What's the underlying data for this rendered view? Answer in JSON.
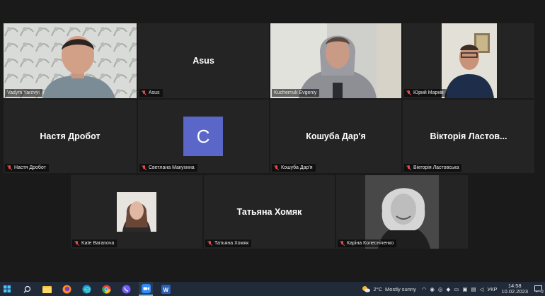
{
  "participants": [
    {
      "name": "Vadym Yarovyi",
      "display": "",
      "video": true,
      "muted": false
    },
    {
      "name": "Asus",
      "display": "Asus",
      "video": false,
      "muted": true
    },
    {
      "name": "Kuchernuk Evgeniy",
      "display": "",
      "video": true,
      "muted": false
    },
    {
      "name": "Юрий Марків",
      "display": "",
      "video": true,
      "muted": true
    },
    {
      "name": "Настя Дробот",
      "display": "Настя Дробот",
      "video": false,
      "muted": true
    },
    {
      "name": "Светлана Макухина",
      "display": "",
      "avatar_letter": "C",
      "video": false,
      "muted": true
    },
    {
      "name": "Кошуба Дар'я",
      "display": "Кошуба Дар'я",
      "video": false,
      "muted": true
    },
    {
      "name": "Вікторія Ластовська",
      "display": "Вікторія Ластов...",
      "video": false,
      "muted": true
    },
    {
      "name": "Kate Baranova",
      "display": "",
      "video": true,
      "muted": true
    },
    {
      "name": "Татьяна Хомяк",
      "display": "Татьяна Хомяк",
      "video": false,
      "muted": true
    },
    {
      "name": "Каріна Колесніченко",
      "display": "",
      "video": true,
      "muted": true
    }
  ],
  "taskbar": {
    "weather_temp": "2°C",
    "weather_text": "Mostly sunny",
    "language": "УКР",
    "time": "14:58",
    "date": "10.02.2023",
    "notification_count": "2"
  },
  "colors": {
    "active_speaker_border": "#b6d84a",
    "avatar_bg": "#5b66c9",
    "muted_red": "#e24b4b",
    "tile_bg": "#242424",
    "taskbar_bg": "#202a38"
  }
}
